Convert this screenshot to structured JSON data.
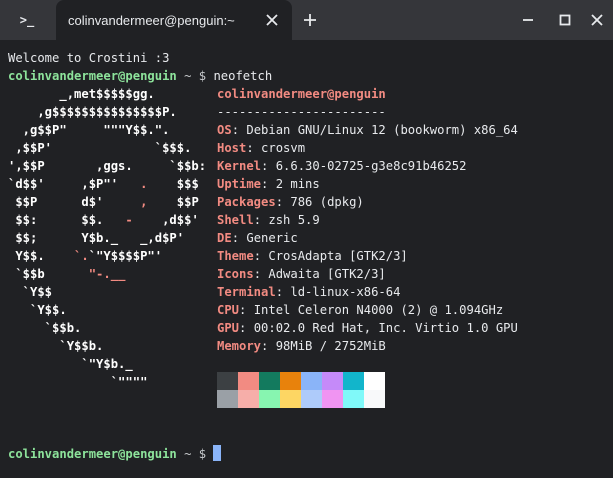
{
  "window": {
    "tab_title": "colinvandermeer@penguin:~",
    "app_icon_text": ">_",
    "icons": {
      "app": "terminal-icon",
      "close_tab": "close-icon",
      "new_tab": "plus-icon",
      "minimize": "minimize-icon",
      "maximize": "maximize-icon",
      "close_window": "close-icon"
    }
  },
  "terminal": {
    "welcome": "Welcome to Crostini :3",
    "prompt_user": "colinvandermeer@penguin",
    "prompt_sep": " ~ $ ",
    "command": "neofetch",
    "final_prompt_user": "colinvandermeer@penguin",
    "final_prompt_sep": " ~ $ "
  },
  "logo_lines": [
    [
      {
        "t": "       _,met$$$$$gg.",
        "c": ""
      }
    ],
    [
      {
        "t": "    ,g$$$$$$$$$$$$$$$P.",
        "c": ""
      }
    ],
    [
      {
        "t": "  ,g$$P\"     \"\"\"Y$$.\".",
        "c": ""
      }
    ],
    [
      {
        "t": " ,$$P'              `$$$.",
        "c": ""
      }
    ],
    [
      {
        "t": "',$$P       ,ggs.     `$$b:",
        "c": ""
      }
    ],
    [
      {
        "t": "`d$$'     ,$P\"'   ",
        "c": ""
      },
      {
        "t": ".",
        "c": "red"
      },
      {
        "t": "    $$$",
        "c": ""
      }
    ],
    [
      {
        "t": " $$P      d$'     ",
        "c": ""
      },
      {
        "t": ",",
        "c": "red"
      },
      {
        "t": "    $$P",
        "c": ""
      }
    ],
    [
      {
        "t": " $$:      $$.   ",
        "c": ""
      },
      {
        "t": "-",
        "c": "red"
      },
      {
        "t": "    ,d$$'",
        "c": ""
      }
    ],
    [
      {
        "t": " $$;      Y$b._   _,d$P'",
        "c": ""
      }
    ],
    [
      {
        "t": " Y$$.    ",
        "c": ""
      },
      {
        "t": "`.",
        "c": "red"
      },
      {
        "t": "`\"Y$$$$P\"'",
        "c": ""
      }
    ],
    [
      {
        "t": " `$$b      ",
        "c": ""
      },
      {
        "t": "\"-.__",
        "c": "red"
      }
    ],
    [
      {
        "t": "  `Y$$",
        "c": ""
      }
    ],
    [
      {
        "t": "   `Y$$.",
        "c": ""
      }
    ],
    [
      {
        "t": "     `$$b.",
        "c": ""
      }
    ],
    [
      {
        "t": "       `Y$$b.",
        "c": ""
      }
    ],
    [
      {
        "t": "          `\"Y$b._",
        "c": ""
      }
    ],
    [
      {
        "t": "              `\"\"\"\"",
        "c": ""
      }
    ]
  ],
  "info": {
    "header": "colinvandermeer@penguin",
    "separator": "-----------------------",
    "rows": [
      {
        "key": "OS",
        "value": ": Debian GNU/Linux 12 (bookworm) x86_64"
      },
      {
        "key": "Host",
        "value": ": crosvm"
      },
      {
        "key": "Kernel",
        "value": ": 6.6.30-02725-g3e8c91b46252"
      },
      {
        "key": "Uptime",
        "value": ": 2 mins"
      },
      {
        "key": "Packages",
        "value": ": 786 (dpkg)"
      },
      {
        "key": "Shell",
        "value": ": zsh 5.9"
      },
      {
        "key": "DE",
        "value": ": Generic"
      },
      {
        "key": "Theme",
        "value": ": CrosAdapta [GTK2/3]"
      },
      {
        "key": "Icons",
        "value": ": Adwaita [GTK2/3]"
      },
      {
        "key": "Terminal",
        "value": ": ld-linux-x86-64"
      },
      {
        "key": "CPU",
        "value": ": Intel Celeron N4000 (2) @ 1.094GHz"
      },
      {
        "key": "GPU",
        "value": ": 00:02.0 Red Hat, Inc. Virtio 1.0 GPU"
      },
      {
        "key": "Memory",
        "value": ": 98MiB / 2752MiB"
      }
    ]
  },
  "palette": {
    "row1": [
      "#3c4043",
      "#f28b82",
      "#137a5e",
      "#e8820c",
      "#8ab4f8",
      "#c58af9",
      "#12b5cb",
      "#ffffff"
    ],
    "row2": [
      "#9aa0a6",
      "#f6aea9",
      "#87f5b0",
      "#fdd663",
      "#aecbfa",
      "#f094f2",
      "#80f9f9",
      "#f8f9fa"
    ]
  }
}
